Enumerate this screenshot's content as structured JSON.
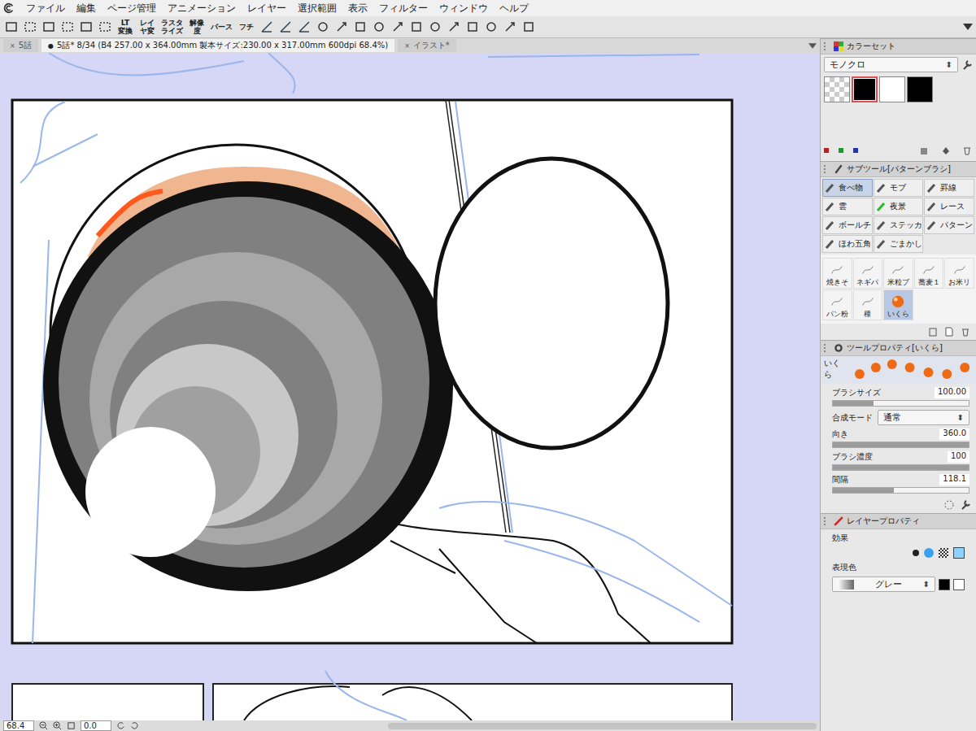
{
  "menu": [
    "ファイル",
    "編集",
    "ページ管理",
    "アニメーション",
    "レイヤー",
    "選択範囲",
    "表示",
    "フィルター",
    "ウィンドウ",
    "ヘルプ"
  ],
  "toolbar": {
    "labels": [
      {
        "lines": [
          "LT",
          "変換"
        ]
      },
      {
        "lines": [
          "レイ",
          "ヤ変"
        ]
      },
      {
        "lines": [
          "ラスタ",
          "ライズ"
        ]
      },
      {
        "lines": [
          "解像",
          "度"
        ]
      },
      {
        "lines": [
          "パース"
        ]
      },
      {
        "lines": [
          "フチ"
        ]
      }
    ]
  },
  "tabs": [
    {
      "label": "5話",
      "selected": false
    },
    {
      "label": "5話* 8/34 (B4 257.00 x 364.00mm 製本サイズ:230.00 x 317.00mm 600dpi 68.4%)",
      "selected": true
    },
    {
      "label": "イラスト*",
      "selected": false
    }
  ],
  "color_set": {
    "title": "カラーセット",
    "set": "モノクロ",
    "swatches": [
      {
        "kind": "transparent",
        "color": "#ffffff",
        "selected": false
      },
      {
        "kind": "solid",
        "color": "#000000",
        "selected": true
      },
      {
        "kind": "solid",
        "color": "#ffffff",
        "selected": false
      },
      {
        "kind": "solid",
        "color": "#000000",
        "selected": false
      }
    ],
    "dots": [
      {
        "color": "#c0201c"
      },
      {
        "color": "#1f9a2a"
      },
      {
        "color": "#2030c0"
      }
    ]
  },
  "subtool": {
    "title": "サブツール[パターンブラシ]",
    "groups": [
      {
        "label": "食べ物",
        "selected": true
      },
      {
        "label": "モブ",
        "selected": false
      },
      {
        "label": "罫線",
        "selected": false
      },
      {
        "label": "雲",
        "selected": false
      },
      {
        "label": "夜景",
        "selected": false
      },
      {
        "label": "レース",
        "selected": false
      },
      {
        "label": "ボールチ",
        "selected": false
      },
      {
        "label": "ステッカ",
        "selected": false
      },
      {
        "label": "パターン",
        "selected": false
      },
      {
        "label": "ほわ五角",
        "selected": false
      },
      {
        "label": "ごまかし",
        "selected": false
      }
    ],
    "brushes": [
      {
        "label": "焼きそ",
        "selected": false
      },
      {
        "label": "ネギパ",
        "selected": false
      },
      {
        "label": "米粒ブ",
        "selected": false
      },
      {
        "label": "蕎麦１",
        "selected": false
      },
      {
        "label": "お米リ",
        "selected": false
      },
      {
        "label": "パン粉",
        "selected": false
      },
      {
        "label": "種",
        "selected": false
      },
      {
        "label": "いくら",
        "selected": true
      }
    ]
  },
  "tool_property": {
    "title": "ツールプロパティ[いくら]",
    "brush": "いくら",
    "rows": [
      {
        "label": "ブラシサイズ",
        "value": "100.00",
        "kind": "slider",
        "level": 0.3
      },
      {
        "label": "合成モード",
        "value": "通常",
        "kind": "dropdown"
      },
      {
        "label": "向き",
        "value": "360.0",
        "kind": "slider",
        "level": 1
      },
      {
        "label": "ブラシ濃度",
        "value": "100",
        "kind": "slider",
        "level": 1
      },
      {
        "label": "間隔",
        "value": "118.1",
        "kind": "slider",
        "level": 0.45
      }
    ]
  },
  "layer_property": {
    "title": "レイヤープロパティ",
    "effect_label": "効果",
    "color_label": "表現色",
    "color_mode": "グレー",
    "colors": [
      "#000000",
      "#ffffff"
    ]
  },
  "status": {
    "zoom": "68.4",
    "angle": "0.0"
  }
}
